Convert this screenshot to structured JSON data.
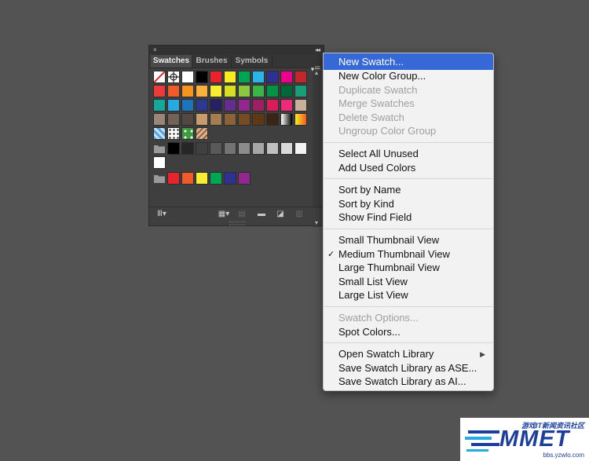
{
  "panel": {
    "close_glyph": "×",
    "collapse_glyph": "◂◂",
    "tabs": [
      {
        "label": "Swatches",
        "active": true
      },
      {
        "label": "Brushes",
        "active": false
      },
      {
        "label": "Symbols",
        "active": false
      }
    ],
    "menu_button_icon": "panel-menu-icon",
    "swatch_rows": [
      [
        "none",
        "registration",
        "#ffffff",
        "#000000",
        "#e8232b",
        "#f7ec22",
        "#00a651",
        "#2bb4e8",
        "#2e3192",
        "#ec008c",
        "#c1272d"
      ],
      [
        "#ed3b3b",
        "#f15a29",
        "#f7941d",
        "#fbb040",
        "#f9ed32",
        "#d7df23",
        "#8dc63f",
        "#39b54a",
        "#009444",
        "#006838",
        "#1b9e77"
      ],
      [
        "#15a99c",
        "#27aae1",
        "#1c75bc",
        "#2b3990",
        "#262262",
        "#662d91",
        "#92278f",
        "#9e1f63",
        "#da1c5c",
        "#ee2a7b",
        "#c7b299"
      ],
      [
        "#998675",
        "#736357",
        "#534741",
        "#c69c6d",
        "#a67c52",
        "#8c6239",
        "#754c24",
        "#603813",
        "#3c2415",
        "gradient-bw",
        "gradient-orange"
      ],
      [
        "pattern-blue",
        "pattern-dots",
        "pattern-leaf",
        "pattern-stone"
      ],
      [
        "folder",
        "#000000",
        "#262626",
        "#404040",
        "#595959",
        "#737373",
        "#8c8c8c",
        "#a6a6a6",
        "#bfbfbf",
        "#d9d9d9",
        "#f2f2f2"
      ],
      [
        "#ffffff"
      ],
      [
        "folder",
        "#e8232b",
        "#f15a29",
        "#f9ed32",
        "#00a651",
        "#2e3192",
        "#92278f"
      ]
    ],
    "bottom_icons": [
      "swatch-libraries-icon",
      "show-kinds-icon",
      "swatch-options-icon",
      "new-color-group-icon",
      "new-swatch-icon",
      "delete-swatch-icon"
    ]
  },
  "menu": {
    "items": [
      {
        "label": "New Swatch...",
        "state": "highlight"
      },
      {
        "label": "New Color Group...",
        "state": "enabled"
      },
      {
        "label": "Duplicate Swatch",
        "state": "disabled"
      },
      {
        "label": "Merge Swatches",
        "state": "disabled"
      },
      {
        "label": "Delete Swatch",
        "state": "disabled"
      },
      {
        "label": "Ungroup Color Group",
        "state": "disabled"
      },
      {
        "sep": true
      },
      {
        "label": "Select All Unused",
        "state": "enabled"
      },
      {
        "label": "Add Used Colors",
        "state": "enabled"
      },
      {
        "sep": true
      },
      {
        "label": "Sort by Name",
        "state": "enabled"
      },
      {
        "label": "Sort by Kind",
        "state": "enabled"
      },
      {
        "label": "Show Find Field",
        "state": "enabled"
      },
      {
        "sep": true
      },
      {
        "label": "Small Thumbnail View",
        "state": "enabled"
      },
      {
        "label": "Medium Thumbnail View",
        "state": "enabled",
        "checked": true
      },
      {
        "label": "Large Thumbnail View",
        "state": "enabled"
      },
      {
        "label": "Small List View",
        "state": "enabled"
      },
      {
        "label": "Large List View",
        "state": "enabled"
      },
      {
        "sep": true
      },
      {
        "label": "Swatch Options...",
        "state": "disabled"
      },
      {
        "label": "Spot Colors...",
        "state": "enabled"
      },
      {
        "sep": true
      },
      {
        "label": "Open Swatch Library",
        "state": "enabled",
        "submenu": true
      },
      {
        "label": "Save Swatch Library as ASE...",
        "state": "enabled"
      },
      {
        "label": "Save Swatch Library as AI...",
        "state": "enabled"
      }
    ],
    "check_glyph": "✓",
    "submenu_glyph": "▶",
    "highlight_color": "#3768d8"
  },
  "watermark": {
    "chinese_text": "游戏IT新闻资讯社区",
    "logo_text": "MMET",
    "url": "bbs.yzwlo.com"
  }
}
